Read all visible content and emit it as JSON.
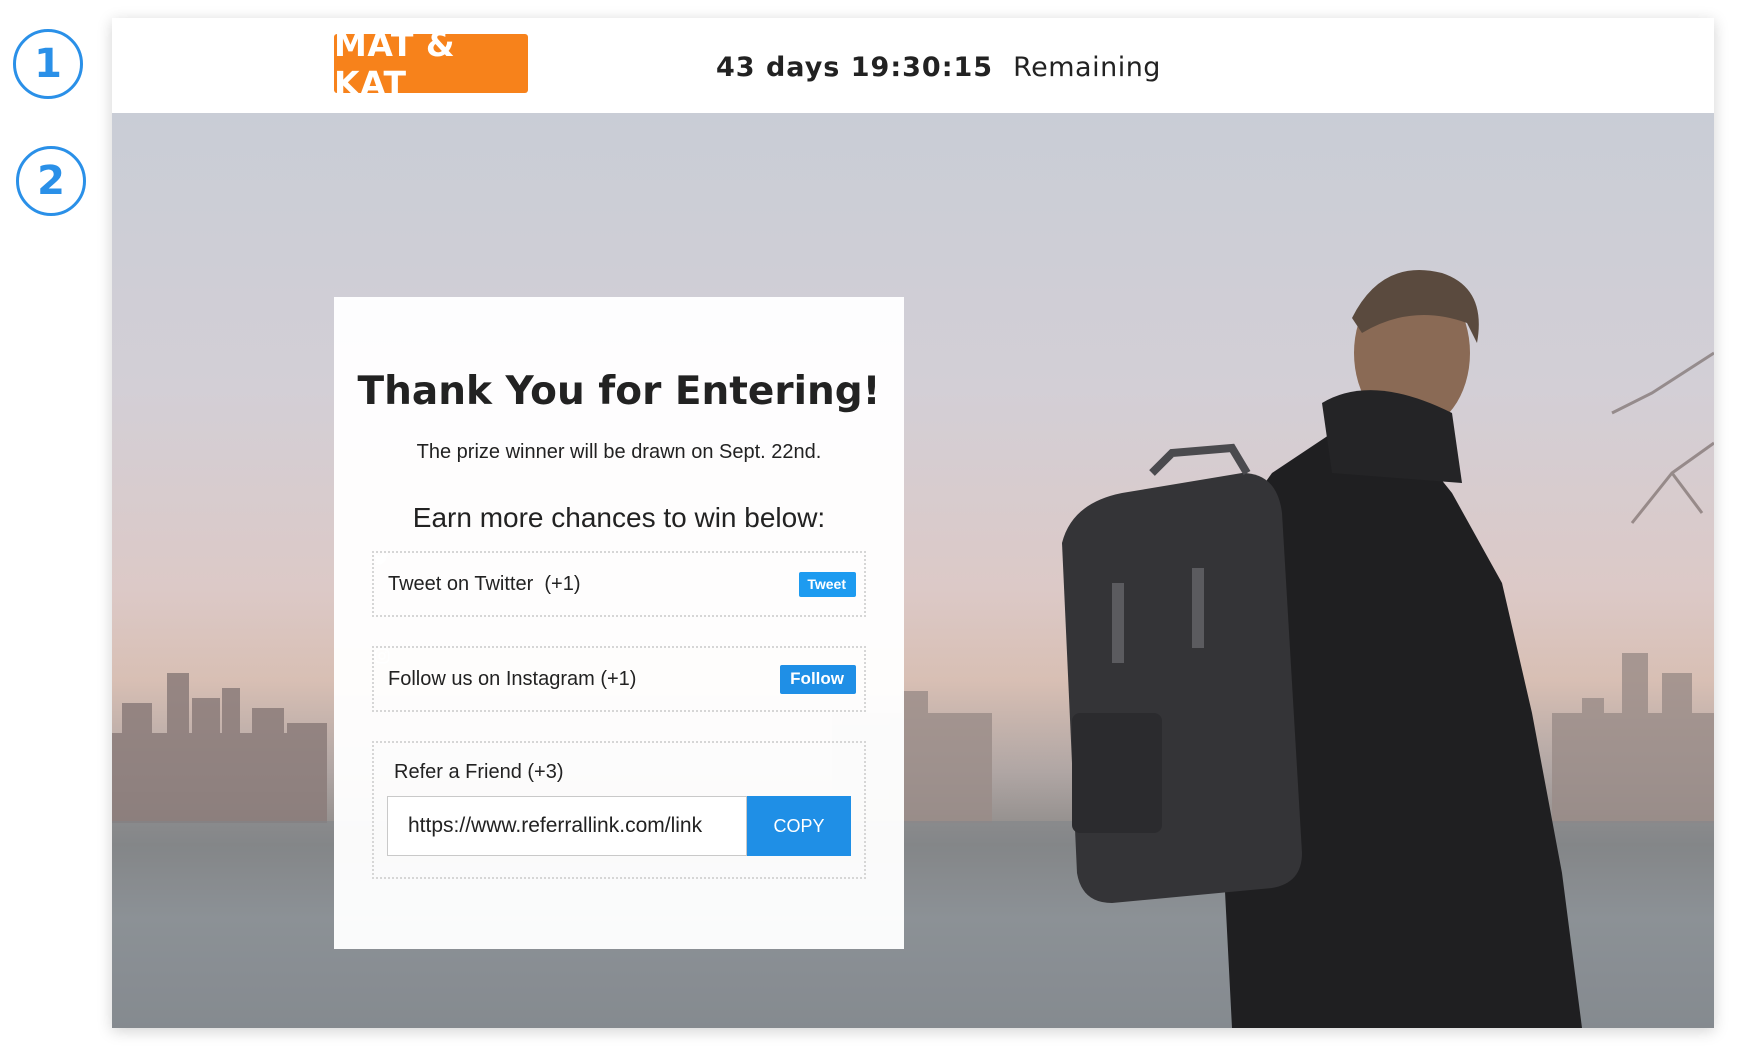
{
  "markers": [
    "1",
    "2"
  ],
  "header": {
    "logo_text": "MAT & KAT",
    "countdown_time": "43 days 19:30:15",
    "countdown_suffix": "Remaining"
  },
  "card": {
    "title": "Thank You for Entering!",
    "subtitle": "The prize winner will be drawn on Sept. 22nd.",
    "earn_heading": "Earn more chances to win below:",
    "actions": [
      {
        "label": "Tweet on Twitter  (+1)",
        "button": "Tweet",
        "icon": "twitter-bird-icon"
      },
      {
        "label": "Follow us on Instagram (+1)",
        "button": "Follow",
        "icon": "instagram-icon"
      }
    ],
    "refer": {
      "label": "Refer a Friend (+3)",
      "link_value": "https://www.referrallink.com/link",
      "copy_button": "COPY"
    }
  },
  "colors": {
    "logo_bg": "#f7821b",
    "button_blue": "#1f8fe6",
    "marker_blue": "#2a90e8"
  }
}
